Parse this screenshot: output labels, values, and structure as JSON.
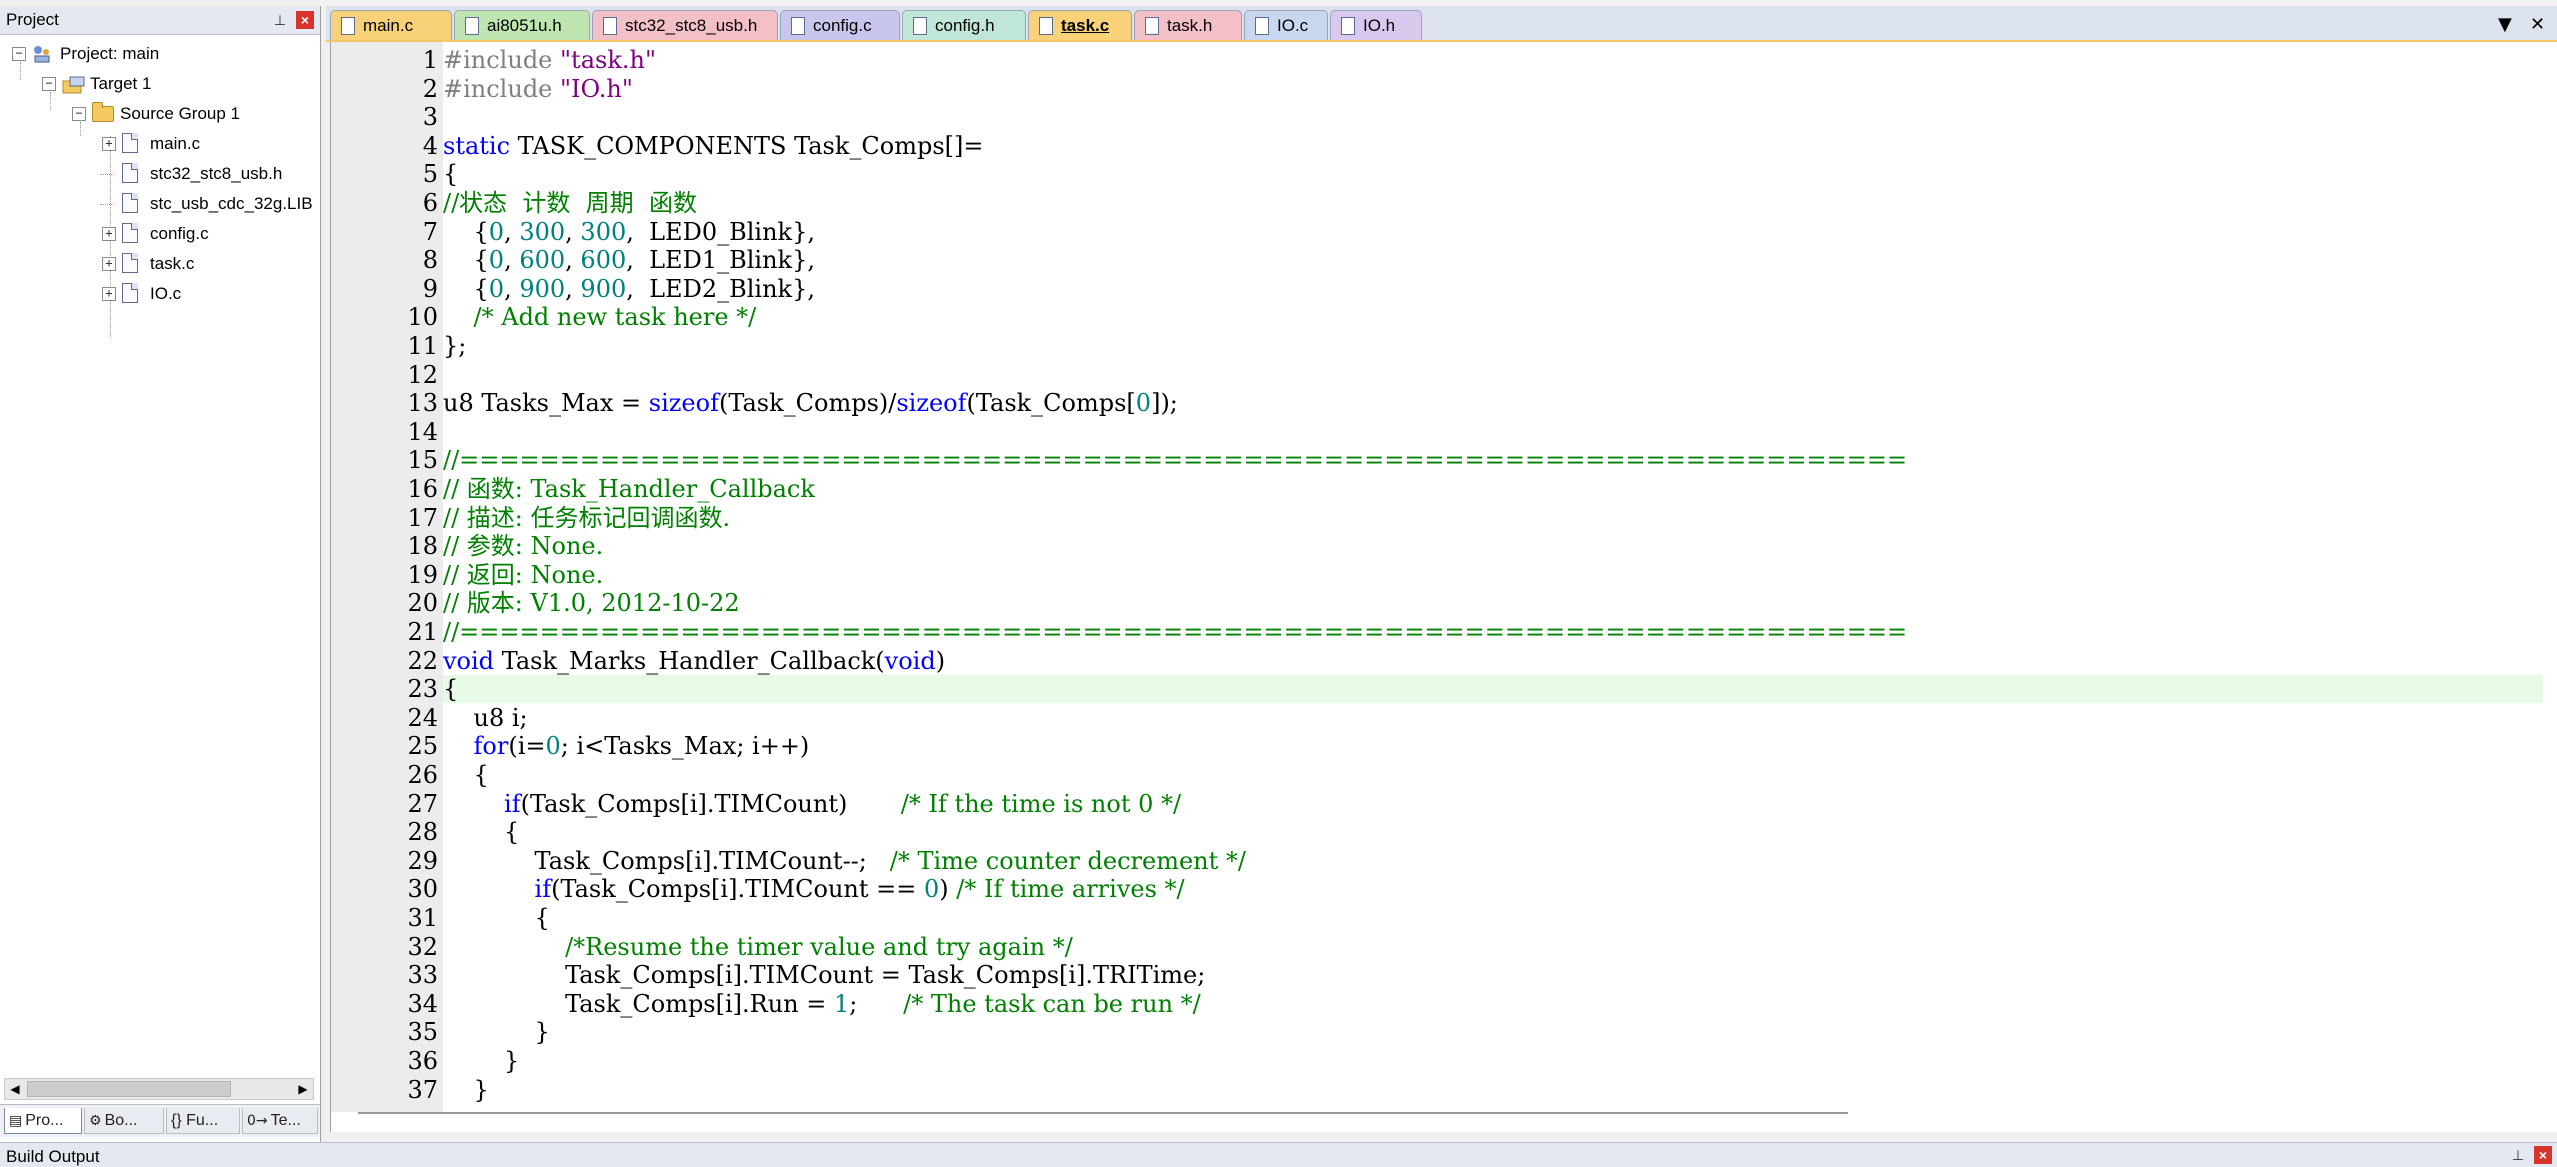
{
  "project_panel": {
    "title": "Project",
    "tree": [
      {
        "label": "Project: main",
        "kind": "project",
        "expander": "−",
        "level": 0
      },
      {
        "label": "Target 1",
        "kind": "target",
        "expander": "−",
        "level": 1
      },
      {
        "label": "Source Group 1",
        "kind": "folder",
        "expander": "−",
        "level": 2
      },
      {
        "label": "main.c",
        "kind": "file",
        "expander": "+",
        "level": 3
      },
      {
        "label": "stc32_stc8_usb.h",
        "kind": "file",
        "expander": "",
        "level": 3
      },
      {
        "label": "stc_usb_cdc_32g.LIB",
        "kind": "file",
        "expander": "",
        "level": 3
      },
      {
        "label": "config.c",
        "kind": "file",
        "expander": "+",
        "level": 3
      },
      {
        "label": "task.c",
        "kind": "file",
        "expander": "+",
        "level": 3
      },
      {
        "label": "IO.c",
        "kind": "file",
        "expander": "+",
        "level": 3
      }
    ],
    "bottom_tabs": [
      {
        "label": "Pro...",
        "icon": "books-icon",
        "glyph": "▤"
      },
      {
        "label": "Bo...",
        "icon": "books-gear-icon",
        "glyph": "⚙"
      },
      {
        "label": "{} Fu...",
        "icon": "functions-icon",
        "glyph": ""
      },
      {
        "label": "Te...",
        "icon": "templates-icon",
        "glyph": "0→"
      }
    ]
  },
  "tabs": [
    {
      "label": "main.c",
      "color": "#f8d178",
      "active": false
    },
    {
      "label": "ai8051u.h",
      "color": "#bfe6b0",
      "active": false
    },
    {
      "label": "stc32_stc8_usb.h",
      "color": "#f4c0c8",
      "active": false
    },
    {
      "label": "config.c",
      "color": "#c9c6ee",
      "active": false
    },
    {
      "label": "config.h",
      "color": "#bfe6d6",
      "active": false
    },
    {
      "label": "task.c",
      "color": "#f8d178",
      "active": true
    },
    {
      "label": "task.h",
      "color": "#f4c0c8",
      "active": false
    },
    {
      "label": "IO.c",
      "color": "#c8d6f0",
      "active": false
    },
    {
      "label": "IO.h",
      "color": "#d8c8ee",
      "active": false
    }
  ],
  "tab_controls": {
    "dropdown": "▼",
    "close": "✕"
  },
  "editor": {
    "current_line": 23,
    "lines": [
      {
        "n": "1",
        "tokens": [
          {
            "t": "#include ",
            "c": "tk-pp"
          },
          {
            "t": "\"task.h\"",
            "c": "tk-str"
          }
        ]
      },
      {
        "n": "2",
        "tokens": [
          {
            "t": "#include ",
            "c": "tk-pp"
          },
          {
            "t": "\"IO.h\"",
            "c": "tk-str"
          }
        ]
      },
      {
        "n": "3",
        "tokens": []
      },
      {
        "n": "4",
        "tokens": [
          {
            "t": "static ",
            "c": "tk-kw"
          },
          {
            "t": "TASK_COMPONENTS Task_Comps[]=",
            "c": ""
          }
        ]
      },
      {
        "n": "5",
        "tokens": [
          {
            "t": "{",
            "c": ""
          }
        ]
      },
      {
        "n": "6",
        "tokens": [
          {
            "t": "//状态  计数  周期  函数",
            "c": "tk-cm"
          }
        ]
      },
      {
        "n": "7",
        "tokens": [
          {
            "t": "    {",
            "c": ""
          },
          {
            "t": "0",
            "c": "tk-num"
          },
          {
            "t": ", ",
            "c": ""
          },
          {
            "t": "300",
            "c": "tk-num"
          },
          {
            "t": ", ",
            "c": ""
          },
          {
            "t": "300",
            "c": "tk-num"
          },
          {
            "t": ",  LED0_Blink},",
            "c": ""
          }
        ]
      },
      {
        "n": "8",
        "tokens": [
          {
            "t": "    {",
            "c": ""
          },
          {
            "t": "0",
            "c": "tk-num"
          },
          {
            "t": ", ",
            "c": ""
          },
          {
            "t": "600",
            "c": "tk-num"
          },
          {
            "t": ", ",
            "c": ""
          },
          {
            "t": "600",
            "c": "tk-num"
          },
          {
            "t": ",  LED1_Blink},",
            "c": ""
          }
        ]
      },
      {
        "n": "9",
        "tokens": [
          {
            "t": "    {",
            "c": ""
          },
          {
            "t": "0",
            "c": "tk-num"
          },
          {
            "t": ", ",
            "c": ""
          },
          {
            "t": "900",
            "c": "tk-num"
          },
          {
            "t": ", ",
            "c": ""
          },
          {
            "t": "900",
            "c": "tk-num"
          },
          {
            "t": ",  LED2_Blink},",
            "c": ""
          }
        ]
      },
      {
        "n": "10",
        "tokens": [
          {
            "t": "    /* Add new task here */",
            "c": "tk-cm"
          }
        ]
      },
      {
        "n": "11",
        "tokens": [
          {
            "t": "};",
            "c": ""
          }
        ]
      },
      {
        "n": "12",
        "tokens": []
      },
      {
        "n": "13",
        "tokens": [
          {
            "t": "u8 Tasks_Max = ",
            "c": ""
          },
          {
            "t": "sizeof",
            "c": "tk-kw"
          },
          {
            "t": "(Task_Comps)/",
            "c": ""
          },
          {
            "t": "sizeof",
            "c": "tk-kw"
          },
          {
            "t": "(Task_Comps[",
            "c": ""
          },
          {
            "t": "0",
            "c": "tk-num"
          },
          {
            "t": "]);",
            "c": ""
          }
        ]
      },
      {
        "n": "14",
        "tokens": []
      },
      {
        "n": "15",
        "tokens": [
          {
            "t": "//========================================================================",
            "c": "tk-cm"
          }
        ]
      },
      {
        "n": "16",
        "tokens": [
          {
            "t": "// 函数: Task_Handler_Callback",
            "c": "tk-cm"
          }
        ]
      },
      {
        "n": "17",
        "tokens": [
          {
            "t": "// 描述: 任务标记回调函数.",
            "c": "tk-cm"
          }
        ]
      },
      {
        "n": "18",
        "tokens": [
          {
            "t": "// 参数: None.",
            "c": "tk-cm"
          }
        ]
      },
      {
        "n": "19",
        "tokens": [
          {
            "t": "// 返回: None.",
            "c": "tk-cm"
          }
        ]
      },
      {
        "n": "20",
        "tokens": [
          {
            "t": "// 版本: V1.0, 2012-10-22",
            "c": "tk-cm"
          }
        ]
      },
      {
        "n": "21",
        "tokens": [
          {
            "t": "//========================================================================",
            "c": "tk-cm"
          }
        ]
      },
      {
        "n": "22",
        "tokens": [
          {
            "t": "void ",
            "c": "tk-kw"
          },
          {
            "t": "Task_Marks_Handler_Callback(",
            "c": ""
          },
          {
            "t": "void",
            "c": "tk-kw"
          },
          {
            "t": ")",
            "c": ""
          }
        ]
      },
      {
        "n": "23",
        "tokens": [
          {
            "t": "{",
            "c": ""
          }
        ]
      },
      {
        "n": "24",
        "tokens": [
          {
            "t": "    u8 i;",
            "c": ""
          }
        ]
      },
      {
        "n": "25",
        "tokens": [
          {
            "t": "    ",
            "c": ""
          },
          {
            "t": "for",
            "c": "tk-kw"
          },
          {
            "t": "(i=",
            "c": ""
          },
          {
            "t": "0",
            "c": "tk-num"
          },
          {
            "t": "; i<Tasks_Max; i++)",
            "c": ""
          }
        ]
      },
      {
        "n": "26",
        "tokens": [
          {
            "t": "    {",
            "c": ""
          }
        ]
      },
      {
        "n": "27",
        "tokens": [
          {
            "t": "        ",
            "c": ""
          },
          {
            "t": "if",
            "c": "tk-kw"
          },
          {
            "t": "(Task_Comps[i].TIMCount)       ",
            "c": ""
          },
          {
            "t": "/* If the time is not 0 */",
            "c": "tk-cm"
          }
        ]
      },
      {
        "n": "28",
        "tokens": [
          {
            "t": "        {",
            "c": ""
          }
        ]
      },
      {
        "n": "29",
        "tokens": [
          {
            "t": "            Task_Comps[i].TIMCount--;   ",
            "c": ""
          },
          {
            "t": "/* Time counter decrement */",
            "c": "tk-cm"
          }
        ]
      },
      {
        "n": "30",
        "tokens": [
          {
            "t": "            ",
            "c": ""
          },
          {
            "t": "if",
            "c": "tk-kw"
          },
          {
            "t": "(Task_Comps[i].TIMCount == ",
            "c": ""
          },
          {
            "t": "0",
            "c": "tk-num"
          },
          {
            "t": ") ",
            "c": ""
          },
          {
            "t": "/* If time arrives */",
            "c": "tk-cm"
          }
        ]
      },
      {
        "n": "31",
        "tokens": [
          {
            "t": "            {",
            "c": ""
          }
        ]
      },
      {
        "n": "32",
        "tokens": [
          {
            "t": "                ",
            "c": ""
          },
          {
            "t": "/*Resume the timer value and try again */",
            "c": "tk-cm"
          }
        ]
      },
      {
        "n": "33",
        "tokens": [
          {
            "t": "                Task_Comps[i].TIMCount = Task_Comps[i].TRITime;",
            "c": ""
          }
        ]
      },
      {
        "n": "34",
        "tokens": [
          {
            "t": "                Task_Comps[i].Run = ",
            "c": ""
          },
          {
            "t": "1",
            "c": "tk-num"
          },
          {
            "t": ";      ",
            "c": ""
          },
          {
            "t": "/* The task can be run */",
            "c": "tk-cm"
          }
        ]
      },
      {
        "n": "35",
        "tokens": [
          {
            "t": "            }",
            "c": ""
          }
        ]
      },
      {
        "n": "36",
        "tokens": [
          {
            "t": "        }",
            "c": ""
          }
        ]
      },
      {
        "n": "37",
        "tokens": [
          {
            "t": "    }",
            "c": ""
          }
        ]
      }
    ]
  },
  "build_output": {
    "title": "Build Output"
  }
}
